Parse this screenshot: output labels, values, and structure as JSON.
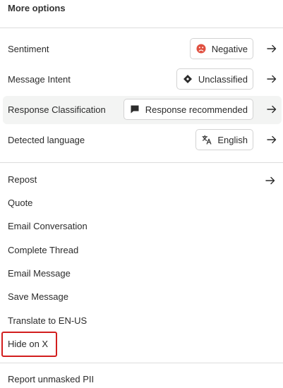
{
  "title": "More options",
  "properties": [
    {
      "label": "Sentiment",
      "value": "Negative",
      "icon": "negative-sentiment-icon"
    },
    {
      "label": "Message Intent",
      "value": "Unclassified",
      "icon": "diamond-icon"
    },
    {
      "label": "Response Classification",
      "value": "Response recommended",
      "icon": "chat-bubble-icon"
    },
    {
      "label": "Detected language",
      "value": "English",
      "icon": "translate-icon"
    }
  ],
  "actions": [
    {
      "label": "Repost",
      "has_arrow": true
    },
    {
      "label": "Quote"
    },
    {
      "label": "Email Conversation"
    },
    {
      "label": "Complete Thread"
    },
    {
      "label": "Email Message"
    },
    {
      "label": "Save Message"
    },
    {
      "label": "Translate to EN-US"
    },
    {
      "label": "Hide on X"
    }
  ],
  "footer_action": "Report unmasked PII",
  "colors": {
    "negative": "#e05040",
    "highlight_bg": "#f3f4f3",
    "focus_outline": "#d21e1e",
    "divider": "#dcdcdc"
  }
}
